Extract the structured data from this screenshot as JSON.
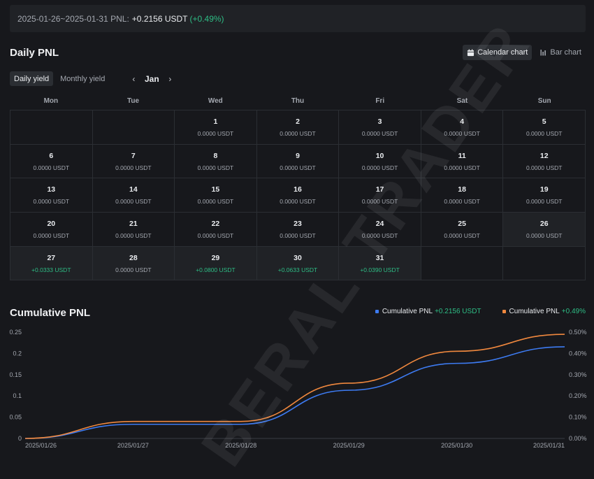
{
  "summary": {
    "range": "2025-01-26~2025-01-31 PNL:",
    "value": "+0.2156 USDT",
    "pct": "(+0.49%)"
  },
  "daily": {
    "title": "Daily PNL",
    "view_toggle": {
      "calendar": "Calendar chart",
      "bar": "Bar chart"
    },
    "tabs": {
      "daily": "Daily yield",
      "monthly": "Monthly yield"
    },
    "month": "Jan",
    "weekdays": [
      "Mon",
      "Tue",
      "Wed",
      "Thu",
      "Fri",
      "Sat",
      "Sun"
    ],
    "leading_blanks": 2,
    "days": [
      {
        "d": "1",
        "v": "0.0000 USDT"
      },
      {
        "d": "2",
        "v": "0.0000 USDT"
      },
      {
        "d": "3",
        "v": "0.0000 USDT"
      },
      {
        "d": "4",
        "v": "0.0000 USDT"
      },
      {
        "d": "5",
        "v": "0.0000 USDT"
      },
      {
        "d": "6",
        "v": "0.0000 USDT"
      },
      {
        "d": "7",
        "v": "0.0000 USDT"
      },
      {
        "d": "8",
        "v": "0.0000 USDT"
      },
      {
        "d": "9",
        "v": "0.0000 USDT"
      },
      {
        "d": "10",
        "v": "0.0000 USDT"
      },
      {
        "d": "11",
        "v": "0.0000 USDT"
      },
      {
        "d": "12",
        "v": "0.0000 USDT"
      },
      {
        "d": "13",
        "v": "0.0000 USDT"
      },
      {
        "d": "14",
        "v": "0.0000 USDT"
      },
      {
        "d": "15",
        "v": "0.0000 USDT"
      },
      {
        "d": "16",
        "v": "0.0000 USDT"
      },
      {
        "d": "17",
        "v": "0.0000 USDT"
      },
      {
        "d": "18",
        "v": "0.0000 USDT"
      },
      {
        "d": "19",
        "v": "0.0000 USDT"
      },
      {
        "d": "20",
        "v": "0.0000 USDT"
      },
      {
        "d": "21",
        "v": "0.0000 USDT"
      },
      {
        "d": "22",
        "v": "0.0000 USDT"
      },
      {
        "d": "23",
        "v": "0.0000 USDT"
      },
      {
        "d": "24",
        "v": "0.0000 USDT"
      },
      {
        "d": "25",
        "v": "0.0000 USDT"
      },
      {
        "d": "26",
        "v": "0.0000 USDT",
        "hl": true
      },
      {
        "d": "27",
        "v": "+0.0333 USDT",
        "pos": true,
        "hl": true
      },
      {
        "d": "28",
        "v": "0.0000 USDT",
        "hl": true
      },
      {
        "d": "29",
        "v": "+0.0800 USDT",
        "pos": true,
        "hl": true
      },
      {
        "d": "30",
        "v": "+0.0633 USDT",
        "pos": true,
        "hl": true
      },
      {
        "d": "31",
        "v": "+0.0390 USDT",
        "pos": true,
        "hl": true
      }
    ]
  },
  "cumulative": {
    "title": "Cumulative PNL",
    "legend": [
      {
        "label": "Cumulative PNL",
        "value": "+0.2156 USDT",
        "color": "#3d7bf2"
      },
      {
        "label": "Cumulative PNL",
        "value": "+0.49%",
        "color": "#f0883e"
      }
    ]
  },
  "watermark": "BERAL TRADER",
  "chart_data": {
    "type": "line",
    "x": [
      "2025/01/26",
      "2025/01/27",
      "2025/01/28",
      "2025/01/29",
      "2025/01/30",
      "2025/01/31"
    ],
    "series": [
      {
        "name": "Cumulative PNL",
        "axis": "left",
        "values": [
          0,
          0.0333,
          0.0333,
          0.1133,
          0.1766,
          0.2156
        ],
        "color": "#3d7bf2"
      },
      {
        "name": "Cumulative PNL",
        "axis": "right",
        "values": [
          0,
          0.0008,
          0.0008,
          0.0026,
          0.0041,
          0.0049
        ],
        "color": "#f0883e"
      }
    ],
    "y_left": {
      "ticks": [
        "0",
        "0.05",
        "0.1",
        "0.15",
        "0.2",
        "0.25"
      ],
      "range": [
        0,
        0.25
      ]
    },
    "y_right": {
      "ticks": [
        "0.00%",
        "0.10%",
        "0.20%",
        "0.30%",
        "0.40%",
        "0.50%"
      ],
      "range": [
        0,
        0.005
      ]
    },
    "grid": false
  }
}
